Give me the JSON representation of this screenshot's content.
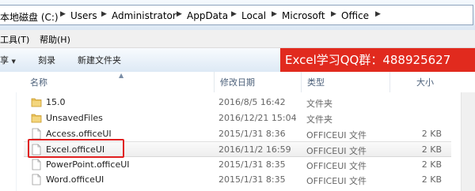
{
  "address": {
    "crumbs": [
      "本地磁盘 (C:)",
      "Users",
      "Administrator",
      "AppData",
      "Local",
      "Microsoft",
      "Office"
    ]
  },
  "menu": {
    "items": [
      "工具(T)",
      "帮助(H)"
    ]
  },
  "toolbar": {
    "share": "享",
    "burn": "刻录",
    "new_folder": "新建文件夹"
  },
  "promo": {
    "text": "Excel学习QQ群：488925627"
  },
  "columns": {
    "name": "名称",
    "date": "修改日期",
    "type": "类型",
    "size": "大小"
  },
  "files": [
    {
      "name": "15.0",
      "date": "2016/8/5 16:42",
      "type": "文件夹",
      "size": "",
      "icon": "folder-icon"
    },
    {
      "name": "UnsavedFiles",
      "date": "2016/12/21 15:04",
      "type": "文件夹",
      "size": "",
      "icon": "folder-icon"
    },
    {
      "name": "Access.officeUI",
      "date": "2015/1/31 8:36",
      "type": "OFFICEUI 文件",
      "size": "2 KB",
      "icon": "file-icon"
    },
    {
      "name": "Excel.officeUI",
      "date": "2016/11/2 16:59",
      "type": "OFFICEUI 文件",
      "size": "2 KB",
      "icon": "file-icon"
    },
    {
      "name": "PowerPoint.officeUI",
      "date": "2015/1/31 8:35",
      "type": "OFFICEUI 文件",
      "size": "2 KB",
      "icon": "file-icon"
    },
    {
      "name": "Word.officeUI",
      "date": "2015/1/31 8:35",
      "type": "OFFICEUI 文件",
      "size": "2 KB",
      "icon": "file-icon"
    }
  ],
  "colors": {
    "highlight": "#e02020",
    "promo_bg": "#e12a1e",
    "folder": "#e8c15a"
  }
}
